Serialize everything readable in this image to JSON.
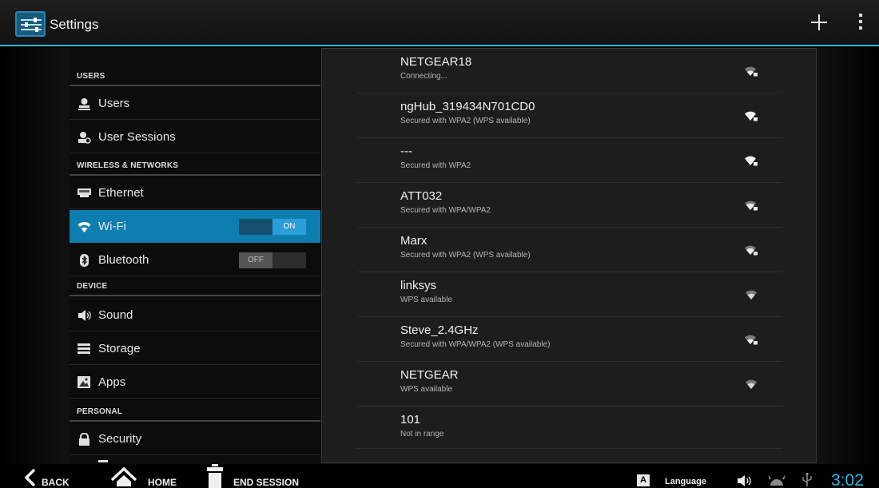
{
  "app": {
    "title": "Settings"
  },
  "sidebar": {
    "categories": [
      "USERS",
      "WIRELESS & NETWORKS",
      "DEVICE",
      "PERSONAL"
    ],
    "items": [
      {
        "label": "Users",
        "icon": "user-icon"
      },
      {
        "label": "User Sessions",
        "icon": "user-sessions-icon"
      },
      {
        "label": "Ethernet",
        "icon": "ethernet-icon"
      },
      {
        "label": "Wi-Fi",
        "icon": "wifi-icon",
        "toggle": "ON",
        "selected": true
      },
      {
        "label": "Bluetooth",
        "icon": "bluetooth-icon",
        "toggle": "OFF"
      },
      {
        "label": "Sound",
        "icon": "sound-icon"
      },
      {
        "label": "Storage",
        "icon": "storage-icon"
      },
      {
        "label": "Apps",
        "icon": "apps-icon"
      },
      {
        "label": "Security",
        "icon": "lock-icon"
      }
    ]
  },
  "networks": [
    {
      "ssid": "NETGEAR18",
      "summary": "Connecting...",
      "secured": true
    },
    {
      "ssid": "ngHub_319434N701CD0",
      "summary": "Secured with WPA2 (WPS available)",
      "secured": true
    },
    {
      "ssid": "---",
      "summary": "Secured with WPA2",
      "secured": true
    },
    {
      "ssid": "ATT032",
      "summary": "Secured with WPA/WPA2",
      "secured": true
    },
    {
      "ssid": "Marx",
      "summary": "Secured with WPA2 (WPS available)",
      "secured": true
    },
    {
      "ssid": "linksys",
      "summary": "WPS available",
      "secured": false
    },
    {
      "ssid": "Steve_2.4GHz",
      "summary": "Secured with WPA/WPA2 (WPS available)",
      "secured": true
    },
    {
      "ssid": "NETGEAR",
      "summary": "WPS available",
      "secured": false
    },
    {
      "ssid": "101",
      "summary": "Not in range",
      "secured": false
    }
  ],
  "navbar": {
    "back": "BACK",
    "home": "HOME",
    "end_session": "END SESSION",
    "language_box": "A",
    "language": "Language",
    "clock": "3:02"
  },
  "colors": {
    "accent": "#33b5e5",
    "selected": "#0e7db0"
  }
}
